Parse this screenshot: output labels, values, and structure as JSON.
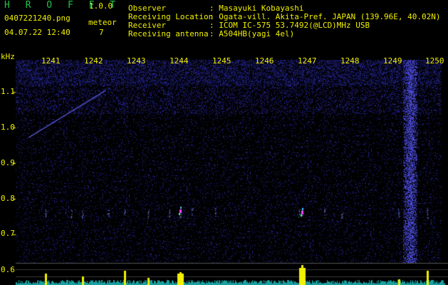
{
  "app": {
    "title": "H R O F F T",
    "version": "1.0.0"
  },
  "file": {
    "name": "0407221240.png",
    "datetime": "04.07.22 12:40"
  },
  "meteor": {
    "label": "meteor",
    "count": "7"
  },
  "info": [
    {
      "key": "Observer",
      "value": ": Masayuki Kobayashi"
    },
    {
      "key": "Receiving Location",
      "value": ": Ogata-vill. Akita-Pref. JAPAN (139.96E, 40.02N)"
    },
    {
      "key": "Receiver",
      "value": ": ICOM IC-575 53.7492(@LCD)MHz USB"
    },
    {
      "key": "Receiving antenna",
      "value": ": A504HB(yagi 4el)"
    }
  ],
  "spectrogram": {
    "unit_label": "kHz",
    "x_ticks": [
      "1241",
      "1242",
      "1243",
      "1244",
      "1245",
      "1246",
      "1247",
      "1248",
      "1249",
      "1250"
    ],
    "y_ticks": [
      "1.1",
      "1.0",
      "0.9",
      "0.8",
      "0.7",
      "0.6"
    ]
  },
  "colors": {
    "background": "#000000",
    "noise": "#1a1a6a",
    "text": "#f0f000",
    "title": "#21c44a",
    "meteor": "#ff40ff"
  }
}
